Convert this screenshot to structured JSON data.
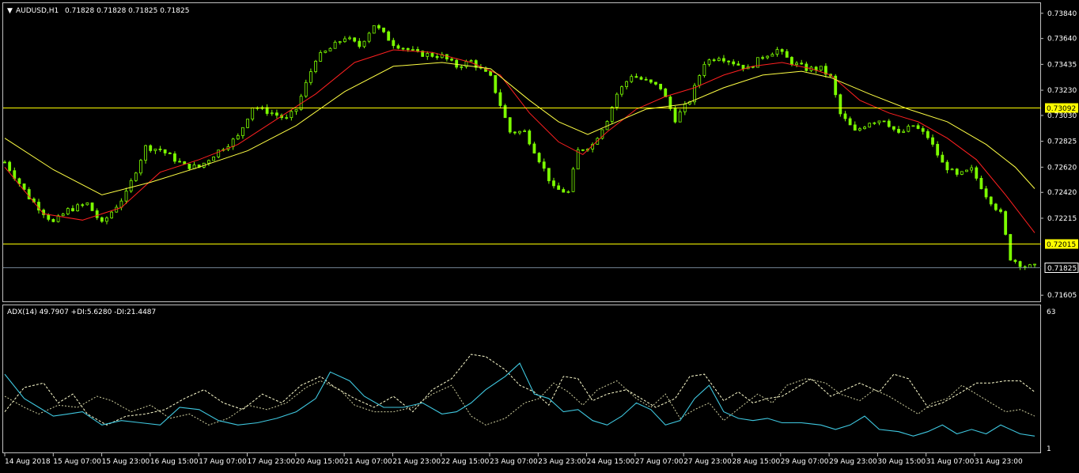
{
  "header": {
    "symbol": "AUDUSD,H1",
    "ohlc": "0.71828 0.71828 0.71825 0.71825"
  },
  "indicator": {
    "label": "ADX(14) 49.7907 +DI:5.6280 -DI:21.4487",
    "scale_max": "63",
    "scale_min": "1"
  },
  "colors": {
    "background": "#000000",
    "border": "#c0c0c0",
    "candle": "#7cfc00",
    "ma_fast": "#ff2020",
    "ma_slow": "#ffff44",
    "level_line": "#ffff00",
    "bid_line": "#708090",
    "adx": "#3fc8e0",
    "plus_di": "#ffffd0",
    "minus_di": "#d0d0a0",
    "text": "#ffffff"
  },
  "chart_data": {
    "type": "candlestick",
    "price_ticks": [
      "0.73840",
      "0.73640",
      "0.73435",
      "0.73230",
      "0.73030",
      "0.72825",
      "0.72620",
      "0.72420",
      "0.72215",
      "0.71605"
    ],
    "price_range": [
      0.71575,
      0.73895
    ],
    "levels": [
      {
        "price": 0.73092,
        "label": "0.73092"
      },
      {
        "price": 0.72015,
        "label": "0.72015"
      }
    ],
    "bid": {
      "price": 0.71825,
      "label": "0.71825"
    },
    "time_labels": [
      "14 Aug 2018",
      "15 Aug 07:00",
      "15 Aug 23:00",
      "16 Aug 15:00",
      "17 Aug 07:00",
      "17 Aug 23:00",
      "20 Aug 15:00",
      "21 Aug 07:00",
      "21 Aug 23:00",
      "22 Aug 15:00",
      "23 Aug 07:00",
      "23 Aug 23:00",
      "24 Aug 15:00",
      "27 Aug 07:00",
      "27 Aug 23:00",
      "28 Aug 15:00",
      "29 Aug 07:00",
      "29 Aug 23:00",
      "30 Aug 15:00",
      "31 Aug 07:00",
      "31 Aug 23:00"
    ],
    "close_path": [
      [
        0,
        0.7266
      ],
      [
        5,
        0.7238
      ],
      [
        10,
        0.7218
      ],
      [
        13,
        0.7228
      ],
      [
        17,
        0.7233
      ],
      [
        20,
        0.7217
      ],
      [
        25,
        0.7241
      ],
      [
        29,
        0.7278
      ],
      [
        32,
        0.7276
      ],
      [
        37,
        0.7263
      ],
      [
        40,
        0.7262
      ],
      [
        44,
        0.7275
      ],
      [
        48,
        0.7286
      ],
      [
        51,
        0.731
      ],
      [
        55,
        0.7305
      ],
      [
        58,
        0.73
      ],
      [
        60,
        0.7308
      ],
      [
        64,
        0.7348
      ],
      [
        67,
        0.7356
      ],
      [
        70,
        0.7365
      ],
      [
        73,
        0.7358
      ],
      [
        76,
        0.7375
      ],
      [
        80,
        0.736
      ],
      [
        85,
        0.7352
      ],
      [
        90,
        0.735
      ],
      [
        93,
        0.7342
      ],
      [
        96,
        0.7346
      ],
      [
        100,
        0.7333
      ],
      [
        104,
        0.729
      ],
      [
        107,
        0.729
      ],
      [
        110,
        0.7268
      ],
      [
        113,
        0.7245
      ],
      [
        116,
        0.7242
      ],
      [
        118,
        0.7275
      ],
      [
        121,
        0.728
      ],
      [
        124,
        0.73
      ],
      [
        126,
        0.732
      ],
      [
        129,
        0.7335
      ],
      [
        132,
        0.733
      ],
      [
        135,
        0.7325
      ],
      [
        138,
        0.73
      ],
      [
        141,
        0.7315
      ],
      [
        144,
        0.7345
      ],
      [
        147,
        0.735
      ],
      [
        150,
        0.7345
      ],
      [
        153,
        0.734
      ],
      [
        156,
        0.735
      ],
      [
        159,
        0.7355
      ],
      [
        162,
        0.7345
      ],
      [
        165,
        0.734
      ],
      [
        168,
        0.734
      ],
      [
        170,
        0.7333
      ],
      [
        172,
        0.7304
      ],
      [
        175,
        0.729
      ],
      [
        178,
        0.7298
      ],
      [
        181,
        0.73
      ],
      [
        184,
        0.7288
      ],
      [
        187,
        0.7295
      ],
      [
        190,
        0.7286
      ],
      [
        193,
        0.7265
      ],
      [
        196,
        0.7255
      ],
      [
        199,
        0.726
      ],
      [
        202,
        0.724
      ],
      [
        205,
        0.7225
      ],
      [
        207,
        0.719
      ],
      [
        210,
        0.7183
      ],
      [
        212,
        0.7183
      ]
    ],
    "series": [
      {
        "values": [
          [
            0,
            0.7262
          ],
          [
            8,
            0.7225
          ],
          [
            16,
            0.722
          ],
          [
            24,
            0.723
          ],
          [
            32,
            0.7258
          ],
          [
            40,
            0.7268
          ],
          [
            48,
            0.728
          ],
          [
            56,
            0.73
          ],
          [
            64,
            0.732
          ],
          [
            72,
            0.7345
          ],
          [
            80,
            0.7355
          ],
          [
            88,
            0.7353
          ],
          [
            96,
            0.7345
          ],
          [
            102,
            0.7335
          ],
          [
            108,
            0.7305
          ],
          [
            114,
            0.7282
          ],
          [
            119,
            0.7272
          ],
          [
            124,
            0.729
          ],
          [
            130,
            0.7308
          ],
          [
            136,
            0.7318
          ],
          [
            142,
            0.7325
          ],
          [
            148,
            0.7335
          ],
          [
            154,
            0.7342
          ],
          [
            160,
            0.7345
          ],
          [
            166,
            0.734
          ],
          [
            170,
            0.7335
          ],
          [
            176,
            0.7315
          ],
          [
            182,
            0.7305
          ],
          [
            188,
            0.7298
          ],
          [
            194,
            0.7285
          ],
          [
            200,
            0.7268
          ],
          [
            206,
            0.724
          ],
          [
            212,
            0.721
          ]
        ]
      },
      {
        "values": [
          [
            0,
            0.7285
          ],
          [
            10,
            0.726
          ],
          [
            20,
            0.724
          ],
          [
            30,
            0.725
          ],
          [
            40,
            0.7262
          ],
          [
            50,
            0.7275
          ],
          [
            60,
            0.7295
          ],
          [
            70,
            0.7322
          ],
          [
            80,
            0.7342
          ],
          [
            90,
            0.7345
          ],
          [
            100,
            0.734
          ],
          [
            108,
            0.7315
          ],
          [
            114,
            0.7298
          ],
          [
            120,
            0.7288
          ],
          [
            126,
            0.7298
          ],
          [
            132,
            0.7308
          ],
          [
            140,
            0.7312
          ],
          [
            148,
            0.7325
          ],
          [
            156,
            0.7335
          ],
          [
            164,
            0.7338
          ],
          [
            170,
            0.7333
          ],
          [
            178,
            0.732
          ],
          [
            186,
            0.7308
          ],
          [
            194,
            0.7298
          ],
          [
            202,
            0.728
          ],
          [
            208,
            0.7262
          ],
          [
            212,
            0.7245
          ]
        ]
      }
    ],
    "adx": [
      [
        0,
        35
      ],
      [
        4,
        24
      ],
      [
        7,
        20
      ],
      [
        10,
        16
      ],
      [
        13,
        17
      ],
      [
        16,
        18
      ],
      [
        20,
        12
      ],
      [
        24,
        14
      ],
      [
        28,
        13
      ],
      [
        32,
        12
      ],
      [
        36,
        20
      ],
      [
        40,
        19
      ],
      [
        44,
        14
      ],
      [
        48,
        12
      ],
      [
        52,
        13
      ],
      [
        56,
        15
      ],
      [
        60,
        18
      ],
      [
        64,
        24
      ],
      [
        67,
        36
      ],
      [
        71,
        32
      ],
      [
        74,
        25
      ],
      [
        78,
        20
      ],
      [
        82,
        20
      ],
      [
        86,
        22
      ],
      [
        90,
        17
      ],
      [
        93,
        18
      ],
      [
        96,
        22
      ],
      [
        99,
        28
      ],
      [
        103,
        34
      ],
      [
        106,
        40
      ],
      [
        109,
        26
      ],
      [
        112,
        24
      ],
      [
        115,
        18
      ],
      [
        118,
        19
      ],
      [
        121,
        14
      ],
      [
        124,
        12
      ],
      [
        127,
        16
      ],
      [
        130,
        22
      ],
      [
        133,
        19
      ],
      [
        136,
        12
      ],
      [
        139,
        14
      ],
      [
        142,
        24
      ],
      [
        145,
        30
      ],
      [
        148,
        18
      ],
      [
        151,
        15
      ],
      [
        154,
        14
      ],
      [
        157,
        15
      ],
      [
        160,
        13
      ],
      [
        164,
        13
      ],
      [
        168,
        12
      ],
      [
        171,
        10
      ],
      [
        174,
        12
      ],
      [
        177,
        16
      ],
      [
        180,
        10
      ],
      [
        184,
        9
      ],
      [
        187,
        7
      ],
      [
        190,
        9
      ],
      [
        193,
        12
      ],
      [
        196,
        8
      ],
      [
        199,
        10
      ],
      [
        202,
        8
      ],
      [
        205,
        12
      ],
      [
        209,
        8
      ],
      [
        212,
        7
      ]
    ],
    "plus_di": [
      [
        0,
        18
      ],
      [
        4,
        29
      ],
      [
        8,
        31
      ],
      [
        11,
        22
      ],
      [
        14,
        26
      ],
      [
        17,
        17
      ],
      [
        21,
        12
      ],
      [
        25,
        16
      ],
      [
        29,
        17
      ],
      [
        33,
        19
      ],
      [
        37,
        24
      ],
      [
        41,
        28
      ],
      [
        45,
        22
      ],
      [
        49,
        19
      ],
      [
        53,
        26
      ],
      [
        57,
        22
      ],
      [
        61,
        30
      ],
      [
        65,
        34
      ],
      [
        68,
        29
      ],
      [
        72,
        24
      ],
      [
        76,
        20
      ],
      [
        80,
        25
      ],
      [
        84,
        18
      ],
      [
        88,
        28
      ],
      [
        92,
        33
      ],
      [
        96,
        44
      ],
      [
        99,
        43
      ],
      [
        103,
        37
      ],
      [
        106,
        30
      ],
      [
        109,
        27
      ],
      [
        112,
        21
      ],
      [
        115,
        34
      ],
      [
        118,
        33
      ],
      [
        121,
        23
      ],
      [
        124,
        26
      ],
      [
        128,
        28
      ],
      [
        131,
        24
      ],
      [
        134,
        20
      ],
      [
        138,
        24
      ],
      [
        141,
        34
      ],
      [
        144,
        35
      ],
      [
        148,
        23
      ],
      [
        151,
        27
      ],
      [
        154,
        22
      ],
      [
        157,
        24
      ],
      [
        160,
        25
      ],
      [
        163,
        29
      ],
      [
        166,
        33
      ],
      [
        170,
        25
      ],
      [
        173,
        28
      ],
      [
        176,
        31
      ],
      [
        180,
        27
      ],
      [
        183,
        35
      ],
      [
        186,
        33
      ],
      [
        190,
        20
      ],
      [
        193,
        22
      ],
      [
        197,
        27
      ],
      [
        200,
        31
      ],
      [
        203,
        31
      ],
      [
        206,
        32
      ],
      [
        209,
        32
      ],
      [
        212,
        27
      ]
    ],
    "minus_di": [
      [
        0,
        25
      ],
      [
        4,
        20
      ],
      [
        7,
        17
      ],
      [
        11,
        21
      ],
      [
        15,
        20
      ],
      [
        19,
        25
      ],
      [
        22,
        23
      ],
      [
        26,
        18
      ],
      [
        30,
        21
      ],
      [
        34,
        15
      ],
      [
        38,
        17
      ],
      [
        42,
        12
      ],
      [
        46,
        15
      ],
      [
        50,
        21
      ],
      [
        54,
        19
      ],
      [
        58,
        22
      ],
      [
        62,
        29
      ],
      [
        65,
        32
      ],
      [
        69,
        28
      ],
      [
        72,
        21
      ],
      [
        76,
        18
      ],
      [
        80,
        18
      ],
      [
        84,
        20
      ],
      [
        88,
        26
      ],
      [
        92,
        30
      ],
      [
        96,
        16
      ],
      [
        99,
        12
      ],
      [
        103,
        15
      ],
      [
        107,
        22
      ],
      [
        110,
        24
      ],
      [
        113,
        31
      ],
      [
        116,
        27
      ],
      [
        119,
        21
      ],
      [
        122,
        28
      ],
      [
        126,
        32
      ],
      [
        130,
        24
      ],
      [
        133,
        20
      ],
      [
        136,
        26
      ],
      [
        139,
        15
      ],
      [
        142,
        19
      ],
      [
        145,
        22
      ],
      [
        148,
        14
      ],
      [
        152,
        21
      ],
      [
        155,
        26
      ],
      [
        158,
        22
      ],
      [
        161,
        30
      ],
      [
        165,
        33
      ],
      [
        169,
        31
      ],
      [
        172,
        26
      ],
      [
        176,
        23
      ],
      [
        179,
        28
      ],
      [
        182,
        25
      ],
      [
        185,
        21
      ],
      [
        188,
        17
      ],
      [
        191,
        22
      ],
      [
        194,
        24
      ],
      [
        197,
        30
      ],
      [
        200,
        26
      ],
      [
        203,
        22
      ],
      [
        206,
        18
      ],
      [
        209,
        19
      ],
      [
        212,
        16
      ]
    ],
    "indicator_range": [
      1,
      63
    ]
  }
}
